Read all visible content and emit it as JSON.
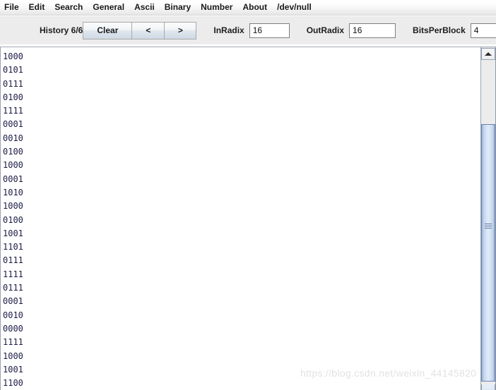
{
  "menubar": {
    "items": [
      {
        "label": "File"
      },
      {
        "label": "Edit"
      },
      {
        "label": "Search"
      },
      {
        "label": "General"
      },
      {
        "label": "Ascii"
      },
      {
        "label": "Binary"
      },
      {
        "label": "Number"
      },
      {
        "label": "About"
      },
      {
        "label": "/dev/null"
      }
    ]
  },
  "toolbar": {
    "history_label": "History 6/6",
    "clear_label": "Clear",
    "prev_label": "<",
    "next_label": ">",
    "inradix_label": "InRadix",
    "inradix_value": "16",
    "outradix_label": "OutRadix",
    "outradix_value": "16",
    "bitsperblock_label": "BitsPerBlock",
    "bitsperblock_value": "4"
  },
  "editor": {
    "lines": [
      "1000",
      "0101",
      "0111",
      "0100",
      "1111",
      "0001",
      "0010",
      "0100",
      "1000",
      "0001",
      "1010",
      "1000",
      "0100",
      "1001",
      "1101",
      "0111",
      "1111",
      "0111",
      "0001",
      "0010",
      "0000",
      "1111",
      "1000",
      "1001",
      "1100"
    ]
  },
  "scrollbar": {
    "up_arrow_icon": "triangle-up-icon",
    "thumb_grip_icon": "grip-lines-icon"
  },
  "watermark": {
    "text": "https://blog.csdn.net/weixin_44145820"
  },
  "colors": {
    "menubar_bg": "#f0f0f0",
    "toolbar_bg": "#ececec",
    "text_color": "#1b1b46",
    "scroll_thumb": "#c6d7ef",
    "field_bg": "#ffffff"
  }
}
